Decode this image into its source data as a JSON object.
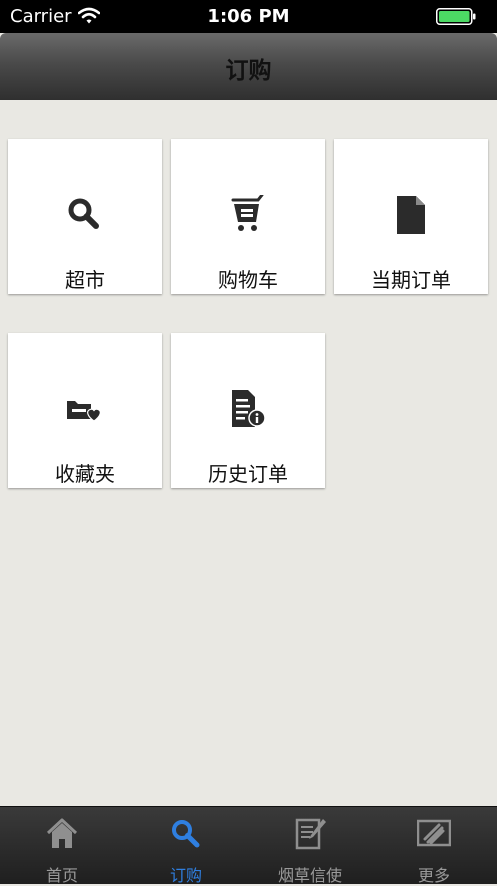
{
  "status_bar": {
    "carrier": "Carrier",
    "time": "1:06 PM",
    "battery_color": "#4cd964"
  },
  "nav_bar": {
    "title": "订购"
  },
  "tiles": [
    {
      "label": "超市",
      "icon": "search-icon"
    },
    {
      "label": "购物车",
      "icon": "cart-icon"
    },
    {
      "label": "当期订单",
      "icon": "document-icon"
    },
    {
      "label": "收藏夹",
      "icon": "favorites-folder-icon"
    },
    {
      "label": "历史订单",
      "icon": "order-history-icon"
    }
  ],
  "tab_bar": {
    "active_color": "#2f7fe0",
    "inactive_color": "#9a9a9a",
    "tabs": [
      {
        "label": "首页",
        "icon": "home-icon",
        "active": false
      },
      {
        "label": "订购",
        "icon": "search-icon",
        "active": true
      },
      {
        "label": "烟草信使",
        "icon": "messenger-icon",
        "active": false
      },
      {
        "label": "更多",
        "icon": "more-icon",
        "active": false
      }
    ]
  }
}
